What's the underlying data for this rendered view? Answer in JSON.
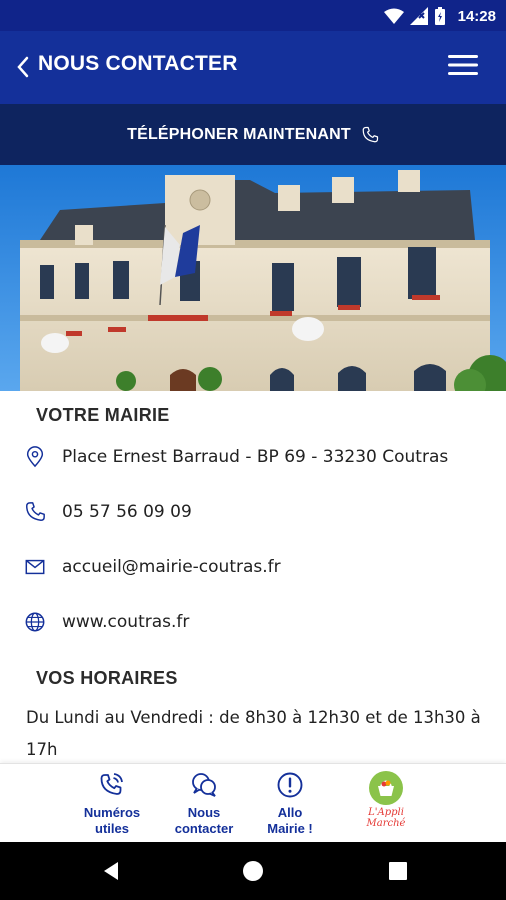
{
  "status_bar": {
    "time": "14:28",
    "icons": [
      "wifi-icon",
      "signal-icon",
      "battery-icon"
    ]
  },
  "app_bar": {
    "title": "NOUS CONTACTER",
    "back_icon": "chevron-left-icon",
    "menu_icon": "hamburger-icon"
  },
  "call_bar": {
    "label": "TÉLÉPHONER MAINTENANT",
    "icon": "phone-icon"
  },
  "hero": {
    "subject": "town-hall-photo"
  },
  "mairie": {
    "title": "VOTRE MAIRIE",
    "address": "Place Ernest Barraud - BP 69 - 33230 Coutras",
    "phone": "05 57 56 09 09",
    "email": "accueil@mairie-coutras.fr",
    "website": "www.coutras.fr"
  },
  "horaires": {
    "title": "VOS HORAIRES",
    "text": "Du Lundi au Vendredi : de 8h30 à 12h30 et de 13h30 à 17h"
  },
  "bottom_nav": {
    "tabs": [
      {
        "label": "Numéros\nutiles",
        "icon": "phone-ring-icon"
      },
      {
        "label": "Nous\ncontacter",
        "icon": "chat-bubbles-icon"
      },
      {
        "label": "Allo\nMairie !",
        "icon": "alert-circle-icon"
      },
      {
        "label": "L'Appli Marché",
        "icon": "market-basket-icon"
      }
    ]
  },
  "colors": {
    "primary": "#14309a",
    "dark_bar": "#0e245f",
    "status": "#10248a",
    "market_green": "#8bc34a",
    "market_red": "#e53935"
  }
}
